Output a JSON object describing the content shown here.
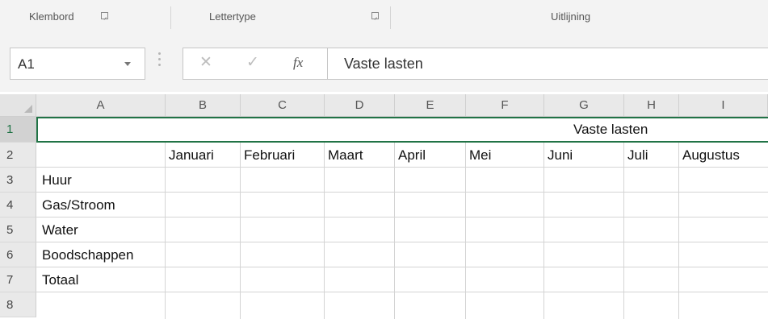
{
  "ribbon": {
    "groups": [
      {
        "label": "Klembord",
        "has_launcher": true
      },
      {
        "label": "Lettertype",
        "has_launcher": true
      },
      {
        "label": "Uitlijning",
        "has_launcher": false
      }
    ]
  },
  "formula_bar": {
    "name_box": "A1",
    "cancel_symbol": "✕",
    "enter_symbol": "✓",
    "fx_symbol": "fx",
    "formula": "Vaste lasten"
  },
  "sheet": {
    "columns": [
      "A",
      "B",
      "C",
      "D",
      "E",
      "F",
      "G",
      "H",
      "I"
    ],
    "rows": [
      "1",
      "2",
      "3",
      "4",
      "5",
      "6",
      "7",
      "8"
    ],
    "merged_title": "Vaste lasten",
    "months": [
      "Januari",
      "Februari",
      "Maart",
      "April",
      "Mei",
      "Juni",
      "Juli",
      "Augustus"
    ],
    "labels": [
      "Huur",
      "Gas/Stroom",
      "Water",
      "Boodschappen",
      "Totaal"
    ],
    "selected_row": "1",
    "accent_color": "#217346"
  }
}
